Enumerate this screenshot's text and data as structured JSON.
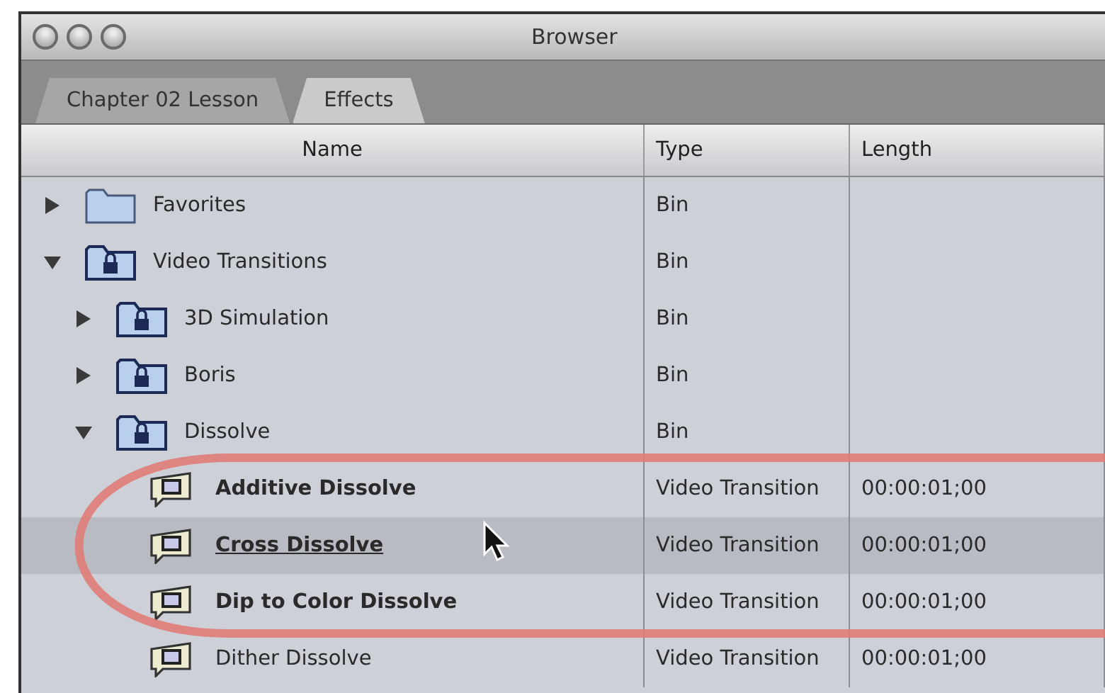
{
  "window": {
    "title": "Browser"
  },
  "tabs": [
    {
      "label": "Chapter 02 Lesson",
      "selected": false
    },
    {
      "label": "Effects",
      "selected": true
    }
  ],
  "table": {
    "columns": [
      "Name",
      "Type",
      "Length"
    ],
    "rows": [
      {
        "name": "Favorites",
        "kind": "folder",
        "expanded": false,
        "type": "Bin"
      },
      {
        "name": "Video Transitions",
        "kind": "locked_bin",
        "expanded": true,
        "type": "Bin",
        "children": [
          {
            "name": "3D Simulation",
            "kind": "locked_bin",
            "expanded": false,
            "type": "Bin"
          },
          {
            "name": "Boris",
            "kind": "locked_bin",
            "expanded": false,
            "type": "Bin"
          },
          {
            "name": "Dissolve",
            "kind": "locked_bin",
            "expanded": true,
            "type": "Bin",
            "children": [
              {
                "name": "Additive Dissolve",
                "kind": "transition",
                "realtime": true,
                "default": false,
                "selected": false,
                "type": "Video Transition",
                "length": "00:00:01;00"
              },
              {
                "name": "Cross Dissolve",
                "kind": "transition",
                "realtime": true,
                "default": true,
                "selected": true,
                "type": "Video Transition",
                "length": "00:00:01;00"
              },
              {
                "name": "Dip to Color Dissolve",
                "kind": "transition",
                "realtime": true,
                "default": false,
                "selected": false,
                "type": "Video Transition",
                "length": "00:00:01;00"
              },
              {
                "name": "Dither Dissolve",
                "kind": "transition",
                "realtime": false,
                "default": false,
                "selected": false,
                "type": "Video Transition",
                "length": "00:00:01;00"
              }
            ]
          }
        ]
      }
    ]
  }
}
